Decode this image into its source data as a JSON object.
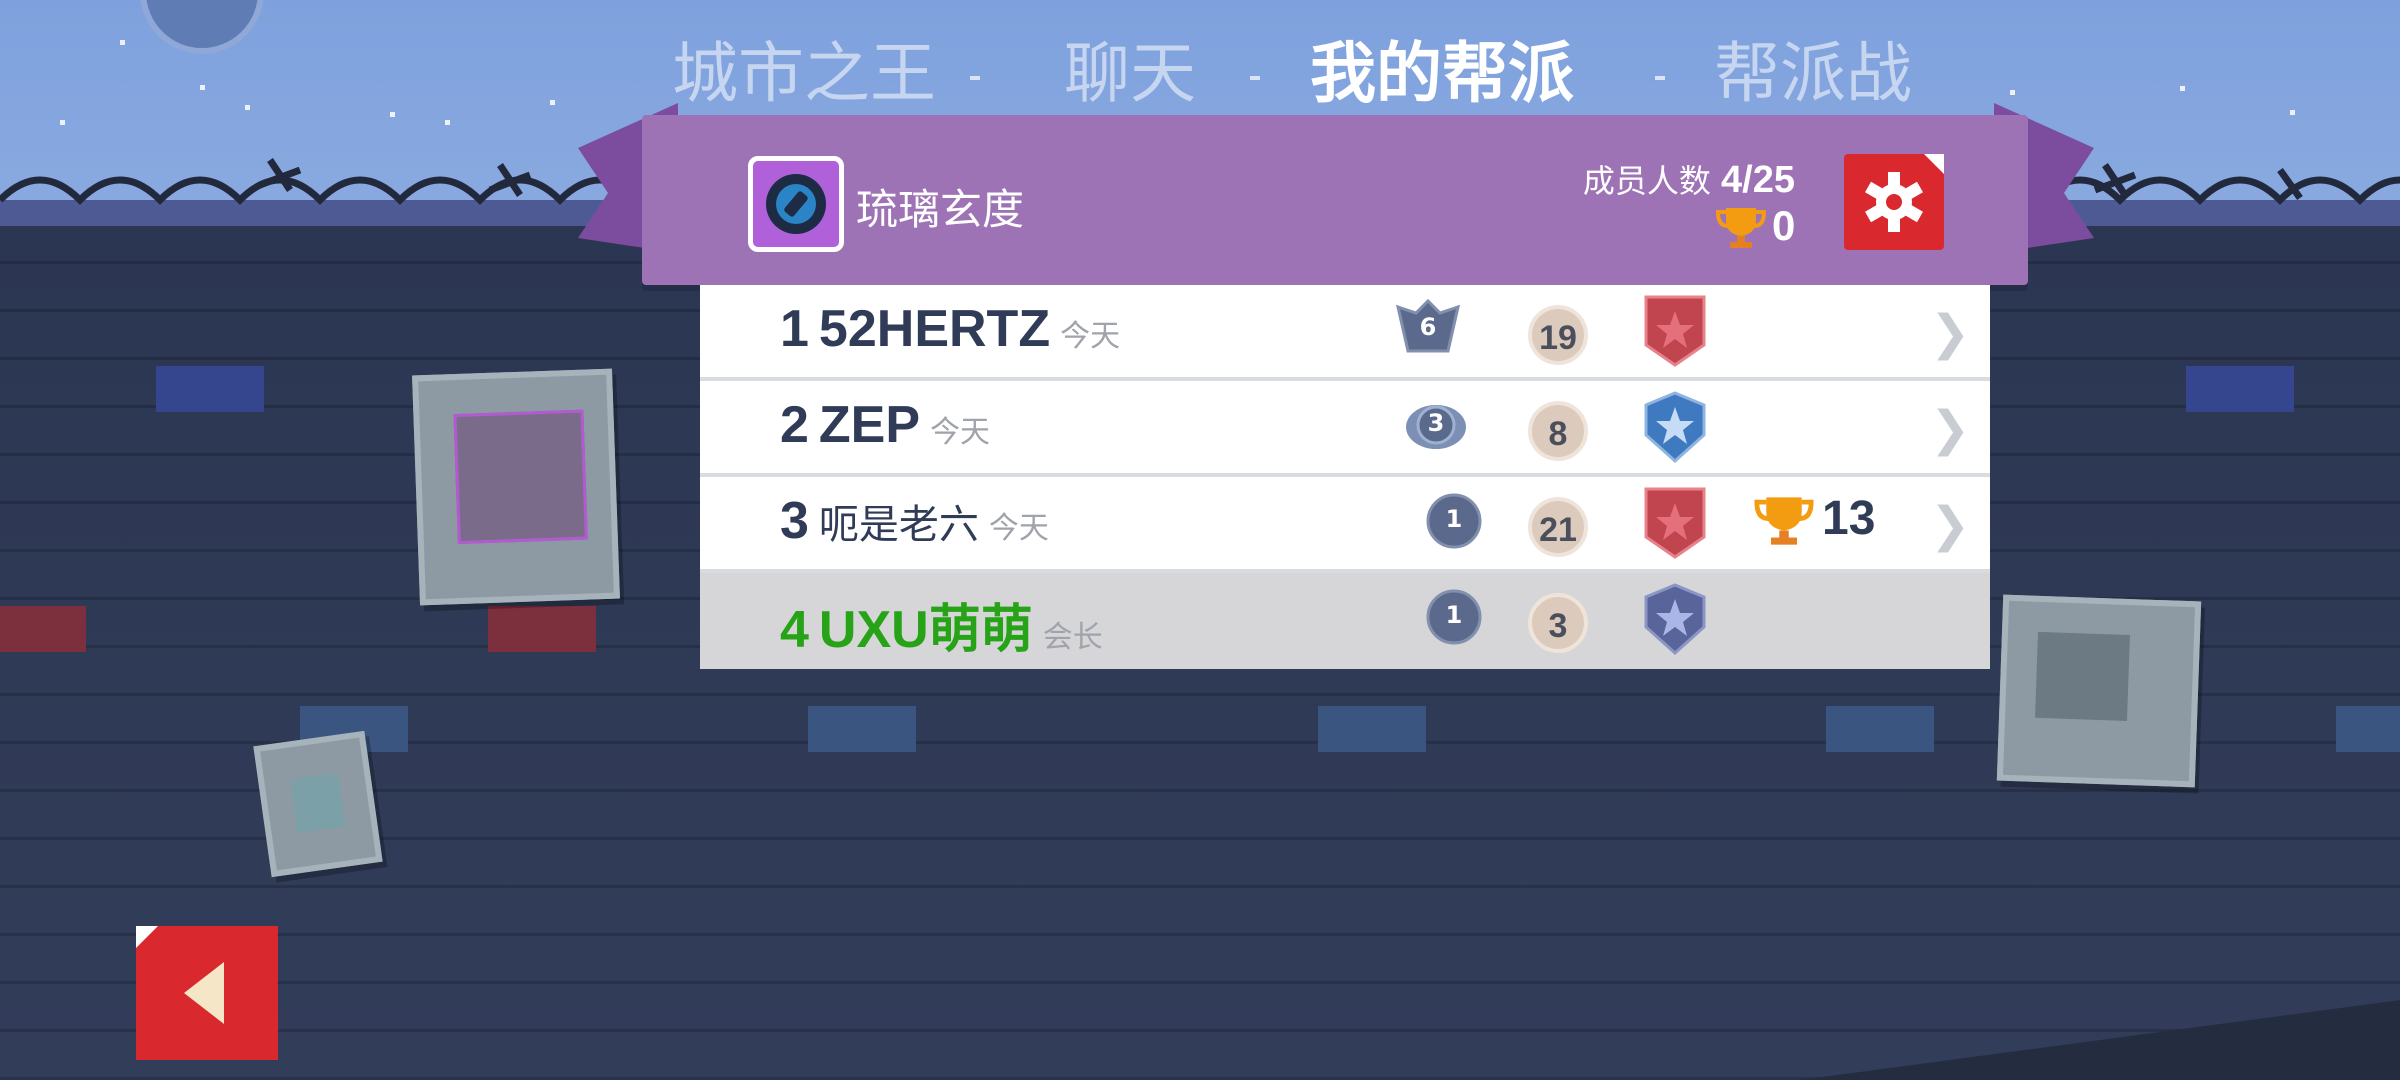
{
  "tabs": [
    {
      "label": "城市之王"
    },
    {
      "label": "聊天"
    },
    {
      "label": "我的帮派"
    },
    {
      "label": "帮派战"
    }
  ],
  "active_tab": "我的帮派",
  "gang": {
    "name": "琉璃玄度",
    "member_label": "成员人数",
    "member_count": "4/25",
    "trophies": "0"
  },
  "members": [
    {
      "rank": "1",
      "name": "52HERTZ",
      "status": "今天",
      "level": "6",
      "coins": "19",
      "trophies": ""
    },
    {
      "rank": "2",
      "name": "ZEP",
      "status": "今天",
      "level": "3",
      "coins": "8",
      "trophies": ""
    },
    {
      "rank": "3",
      "name": "呃是老六",
      "status": "今天",
      "level": "1",
      "coins": "21",
      "trophies": "13"
    },
    {
      "rank": "4",
      "name": "UXU萌萌",
      "status": "会长",
      "level": "1",
      "coins": "3",
      "trophies": ""
    }
  ],
  "icons": {
    "settings": "gear-icon",
    "back": "back-arrow-icon",
    "trophy": "trophy-icon",
    "chevron": "chevron-right-icon"
  },
  "colors": {
    "accent_red": "#d9282e",
    "ribbon_purple": "#9e73b6",
    "self_green": "#27a317"
  }
}
